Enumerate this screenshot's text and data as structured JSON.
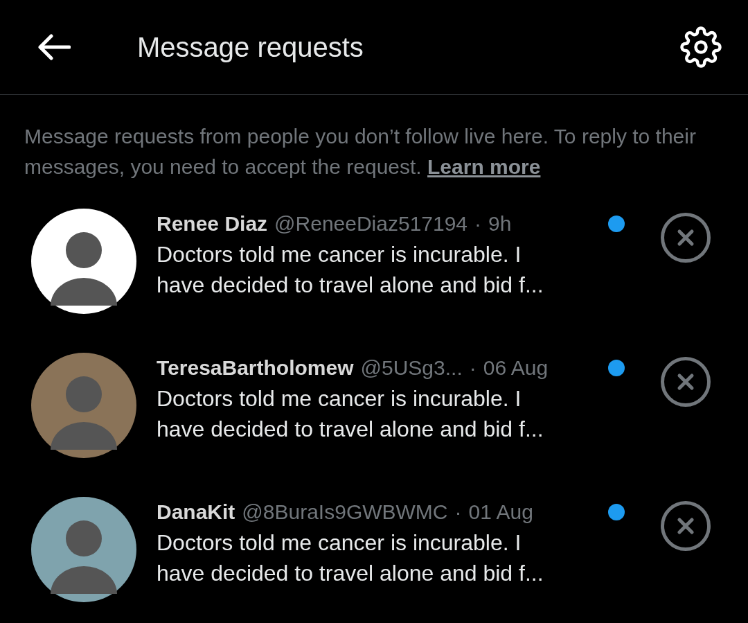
{
  "header": {
    "title": "Message requests"
  },
  "intro": {
    "text": "Message requests from people you don’t follow live here. To reply to their messages, you need to accept the request.",
    "link": "Learn more"
  },
  "requests": [
    {
      "name": "Renee Diaz",
      "handle": "@ReneeDiaz517194",
      "separator": "·",
      "time": "9h",
      "message": "Doctors told me cancer is incurable. I have decided to travel alone and bid f...",
      "unread": true,
      "color": "#ffffff"
    },
    {
      "name": "TeresaBartholomew",
      "handle": "@5USg3...",
      "separator": "·",
      "time": "06 Aug",
      "message": "Doctors told me cancer is incurable. I have decided to travel alone and bid f...",
      "unread": true,
      "color": "#8a7358"
    },
    {
      "name": "DanaKit",
      "handle": "@8BuraIs9GWBWMC",
      "separator": "·",
      "time": "01 Aug",
      "message": "Doctors told me cancer is incurable. I have decided to travel alone and bid f...",
      "unread": true,
      "color": "#7fa3ad"
    }
  ]
}
